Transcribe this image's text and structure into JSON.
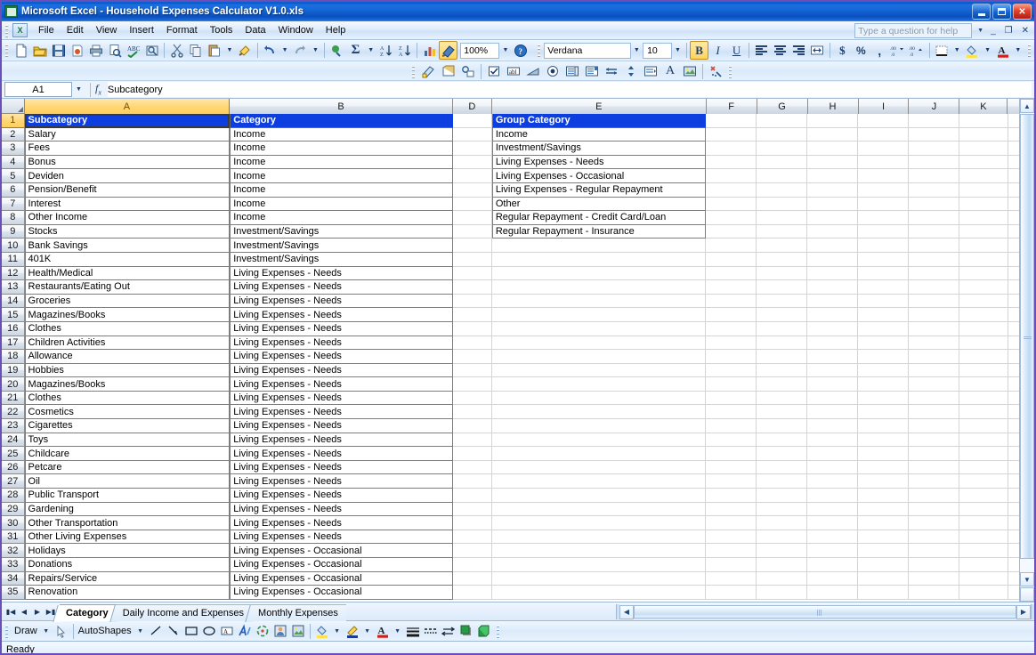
{
  "window": {
    "title": "Microsoft Excel - Household Expenses Calculator V1.0.xls",
    "app_icon": "excel-icon",
    "minimize_label": "Minimize",
    "maximize_label": "Maximize",
    "close_label": "Close"
  },
  "menubar": {
    "items": [
      {
        "label": "File"
      },
      {
        "label": "Edit"
      },
      {
        "label": "View"
      },
      {
        "label": "Insert"
      },
      {
        "label": "Format"
      },
      {
        "label": "Tools"
      },
      {
        "label": "Data"
      },
      {
        "label": "Window"
      },
      {
        "label": "Help"
      }
    ],
    "ask_placeholder": "Type a question for help"
  },
  "toolbar": {
    "zoom_value": "100%",
    "font_name": "Verdana",
    "font_size": "10",
    "bold_label": "B",
    "italic_label": "I",
    "underline_label": "U",
    "currency_label": "$",
    "percent_label": "%",
    "comma_label": ",",
    "sum_label": "Σ",
    "standard_icons": [
      "new-icon",
      "open-icon",
      "save-icon",
      "permission-icon",
      "print-icon",
      "print-preview-icon",
      "spelling-icon",
      "research-icon",
      "cut-icon",
      "copy-icon",
      "paste-icon",
      "format-painter-icon",
      "undo-icon",
      "redo-icon",
      "hyperlink-icon",
      "autosum-icon",
      "sort-asc-icon",
      "sort-desc-icon",
      "chart-wizard-icon",
      "drawing-icon",
      "help-icon"
    ],
    "forms_icons": [
      "edit-box-icon",
      "group-box-icon",
      "speech-icon",
      "check-box-icon",
      "label-icon",
      "triangle-icon",
      "option-button-icon",
      "list-box-icon",
      "combo-box-icon",
      "scroll-bar-icon",
      "spinner-icon",
      "combo-list-icon",
      "text-icon",
      "image-icon",
      "control-properties-icon"
    ]
  },
  "formula_bar": {
    "name_box": "A1",
    "fx_label": "fx",
    "formula_value": "Subcategory"
  },
  "grid": {
    "column_headers": [
      "A",
      "B",
      "D",
      "E",
      "F",
      "G",
      "H",
      "I",
      "J",
      "K"
    ],
    "selected_column": "A",
    "selected_row": "1",
    "rows": [
      {
        "num": "1",
        "a": "Subcategory",
        "b": "Category",
        "e": "Group Category"
      },
      {
        "num": "2",
        "a": "Salary",
        "b": "Income",
        "e": "Income"
      },
      {
        "num": "3",
        "a": "Fees",
        "b": "Income",
        "e": "Investment/Savings"
      },
      {
        "num": "4",
        "a": "Bonus",
        "b": "Income",
        "e": "Living Expenses - Needs"
      },
      {
        "num": "5",
        "a": "Deviden",
        "b": "Income",
        "e": "Living Expenses - Occasional"
      },
      {
        "num": "6",
        "a": "Pension/Benefit",
        "b": "Income",
        "e": "Living Expenses - Regular Repayment"
      },
      {
        "num": "7",
        "a": "Interest",
        "b": "Income",
        "e": "Other"
      },
      {
        "num": "8",
        "a": "Other Income",
        "b": "Income",
        "e": "Regular Repayment - Credit Card/Loan"
      },
      {
        "num": "9",
        "a": "Stocks",
        "b": "Investment/Savings",
        "e": "Regular Repayment - Insurance"
      },
      {
        "num": "10",
        "a": "Bank Savings",
        "b": "Investment/Savings",
        "e": ""
      },
      {
        "num": "11",
        "a": "401K",
        "b": "Investment/Savings",
        "e": ""
      },
      {
        "num": "12",
        "a": "Health/Medical",
        "b": "Living Expenses - Needs",
        "e": ""
      },
      {
        "num": "13",
        "a": "Restaurants/Eating Out",
        "b": "Living Expenses - Needs",
        "e": ""
      },
      {
        "num": "14",
        "a": "Groceries",
        "b": "Living Expenses - Needs",
        "e": ""
      },
      {
        "num": "15",
        "a": "Magazines/Books",
        "b": "Living Expenses - Needs",
        "e": ""
      },
      {
        "num": "16",
        "a": "Clothes",
        "b": "Living Expenses - Needs",
        "e": ""
      },
      {
        "num": "17",
        "a": "Children Activities",
        "b": "Living Expenses - Needs",
        "e": ""
      },
      {
        "num": "18",
        "a": "Allowance",
        "b": "Living Expenses - Needs",
        "e": ""
      },
      {
        "num": "19",
        "a": "Hobbies",
        "b": "Living Expenses - Needs",
        "e": ""
      },
      {
        "num": "20",
        "a": "Magazines/Books",
        "b": "Living Expenses - Needs",
        "e": ""
      },
      {
        "num": "21",
        "a": "Clothes",
        "b": "Living Expenses - Needs",
        "e": ""
      },
      {
        "num": "22",
        "a": "Cosmetics",
        "b": "Living Expenses - Needs",
        "e": ""
      },
      {
        "num": "23",
        "a": "Cigarettes",
        "b": "Living Expenses - Needs",
        "e": ""
      },
      {
        "num": "24",
        "a": "Toys",
        "b": "Living Expenses - Needs",
        "e": ""
      },
      {
        "num": "25",
        "a": "Childcare",
        "b": "Living Expenses - Needs",
        "e": ""
      },
      {
        "num": "26",
        "a": "Petcare",
        "b": "Living Expenses - Needs",
        "e": ""
      },
      {
        "num": "27",
        "a": "Oil",
        "b": "Living Expenses - Needs",
        "e": ""
      },
      {
        "num": "28",
        "a": "Public Transport",
        "b": "Living Expenses - Needs",
        "e": ""
      },
      {
        "num": "29",
        "a": "Gardening",
        "b": "Living Expenses - Needs",
        "e": ""
      },
      {
        "num": "30",
        "a": "Other Transportation",
        "b": "Living Expenses - Needs",
        "e": ""
      },
      {
        "num": "31",
        "a": "Other Living Expenses",
        "b": "Living Expenses - Needs",
        "e": ""
      },
      {
        "num": "32",
        "a": "Holidays",
        "b": "Living Expenses - Occasional",
        "e": ""
      },
      {
        "num": "33",
        "a": "Donations",
        "b": "Living Expenses - Occasional",
        "e": ""
      },
      {
        "num": "34",
        "a": "Repairs/Service",
        "b": "Living Expenses - Occasional",
        "e": ""
      },
      {
        "num": "35",
        "a": "Renovation",
        "b": "Living Expenses - Occasional",
        "e": ""
      }
    ]
  },
  "sheet_tabs": {
    "tabs": [
      {
        "label": "Category",
        "active": true
      },
      {
        "label": "Daily Income and Expenses",
        "active": false
      },
      {
        "label": "Monthly Expenses",
        "active": false
      }
    ],
    "nav_first": "first-sheet",
    "nav_prev": "prev-sheet",
    "nav_next": "next-sheet",
    "nav_last": "last-sheet"
  },
  "draw_toolbar": {
    "draw_label": "Draw",
    "autoshapes_label": "AutoShapes",
    "icons": [
      "select-objects-icon",
      "line-icon",
      "arrow-icon",
      "rectangle-icon",
      "oval-icon",
      "text-box-icon",
      "wordart-icon",
      "diagram-icon",
      "clip-art-icon",
      "picture-icon",
      "fill-color-icon",
      "line-color-icon",
      "font-color-icon",
      "line-style-icon",
      "dash-style-icon",
      "arrow-style-icon",
      "shadow-style-icon",
      "3d-style-icon"
    ]
  },
  "statusbar": {
    "status_text": "Ready"
  },
  "colors": {
    "header_blue": "#0d3fe0",
    "selected_header": "#ffd777",
    "title_blue": "#1568d6",
    "accent": "#0a4fc0"
  }
}
